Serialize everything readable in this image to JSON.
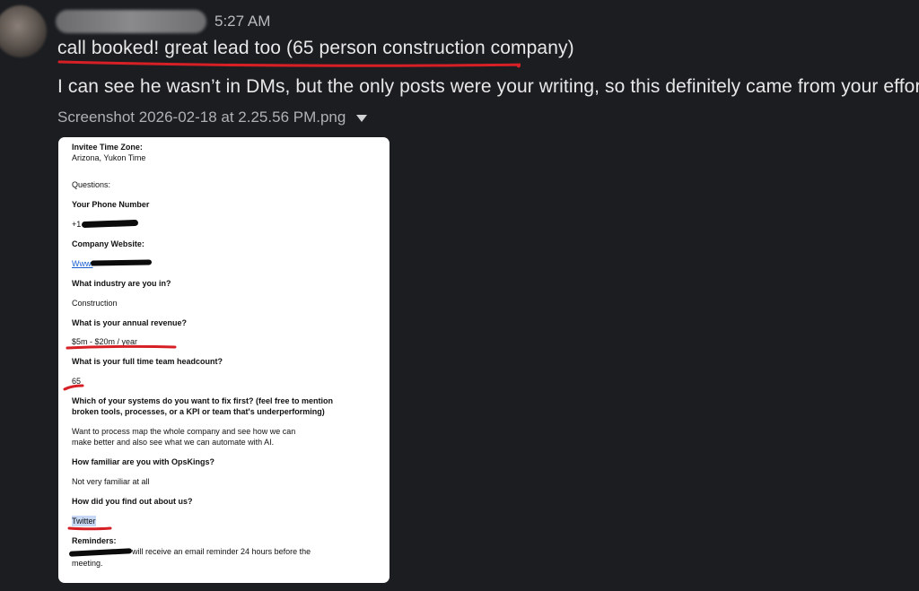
{
  "message": {
    "time": "5:27 AM",
    "line1": "call booked! great lead too (65 person construction company)",
    "line2": "I can see he wasn’t in DMs, but the only posts were your writing, so this definitely came from your efforts",
    "attachment_name": "Screenshot 2026-02-18 at 2.25.56 PM.png"
  },
  "form": {
    "tz_label": "Invitee Time Zone:",
    "tz_value": "Arizona, Yukon Time",
    "questions": "Questions:",
    "phone_label": "Your Phone Number",
    "phone_prefix": "+1",
    "website_label": "Company Website:",
    "website_prefix": "Www.",
    "industry_label": "What industry are you in?",
    "industry_value": "Construction",
    "revenue_label": "What is your annual revenue?",
    "revenue_value": "$5m - $20m / year",
    "headcount_label": "What is your full time team headcount?",
    "headcount_value": "65",
    "systems_label_1": "Which of your systems do you want to fix first? (feel free to mention",
    "systems_label_2": "broken tools, processes, or a KPI or team that's underperforming)",
    "systems_value_1": "Want to process map the whole company and see how we can",
    "systems_value_2": "make better and also see what we can automate with AI.",
    "familiar_label": "How familiar are you with OpsKings?",
    "familiar_value": "Not very familiar at all",
    "findout_label": "How did you find out about us?",
    "findout_value": "Twitter",
    "reminders_label": "Reminders:",
    "reminders_value_1": "will receive an email reminder 24 hours before the",
    "reminders_value_2": "meeting."
  }
}
